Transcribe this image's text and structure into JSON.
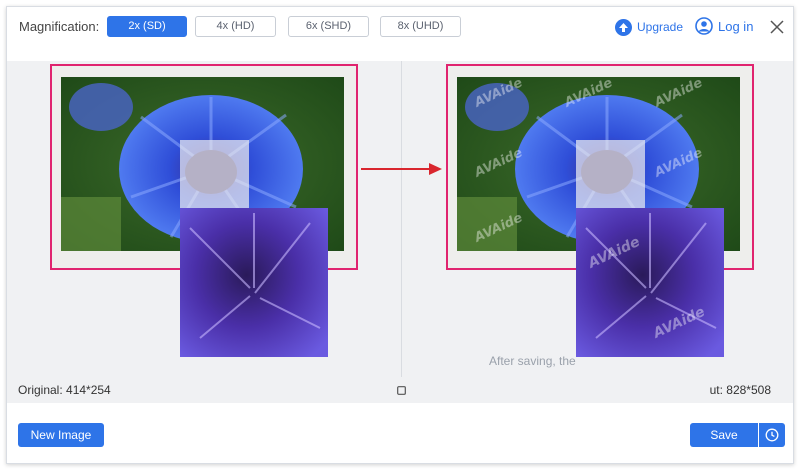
{
  "header": {
    "magnification_label": "Magnification:",
    "options": [
      {
        "label": "2x (SD)",
        "selected": true
      },
      {
        "label": "4x (HD)",
        "selected": false
      },
      {
        "label": "6x (SHD)",
        "selected": false
      },
      {
        "label": "8x (UHD)",
        "selected": false
      }
    ],
    "upgrade_label": "Upgrade",
    "login_label": "Log in"
  },
  "workspace": {
    "original_size": "Original: 414*254",
    "output_size": "ut: 828*508",
    "after_saving_text": "After saving, the",
    "watermark": "AVAide"
  },
  "footer": {
    "new_image_label": "New Image",
    "save_label": "Save"
  },
  "colors": {
    "accent": "#2e74e8",
    "highlight_frame": "#e0246f",
    "arrow": "#d9262e"
  },
  "icons": {
    "upgrade": "upgrade-arrow-icon",
    "login": "user-icon",
    "close": "close-icon",
    "fit": "fit-screen-icon",
    "history": "clock-icon"
  }
}
